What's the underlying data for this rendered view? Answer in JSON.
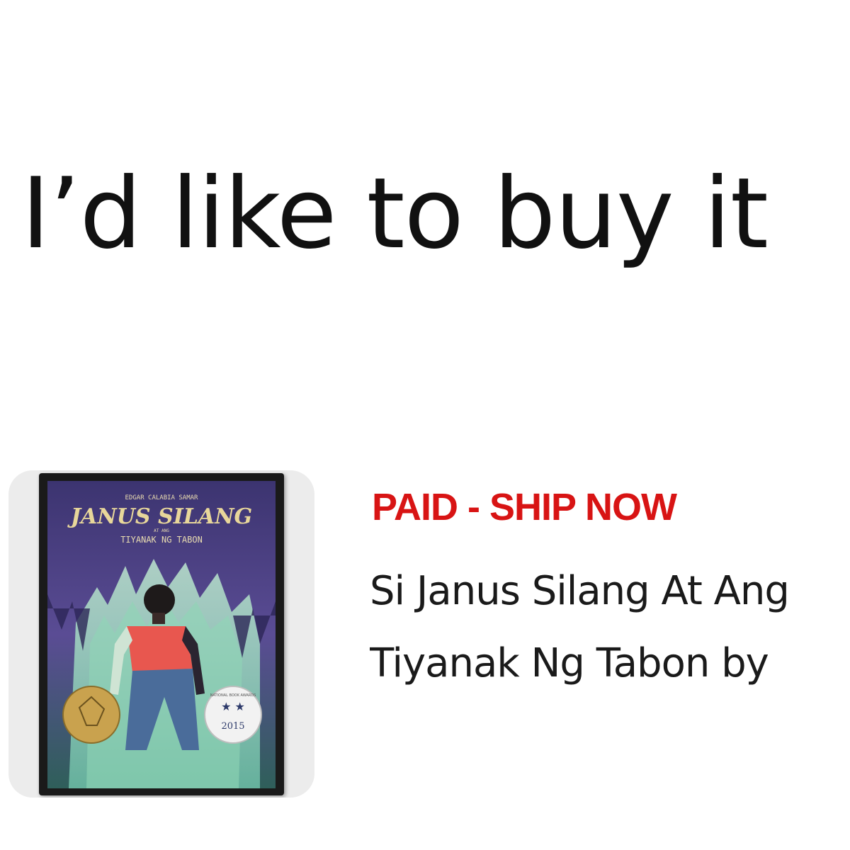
{
  "headline": "I’d like to buy it",
  "listing": {
    "status": "PAID - SHIP NOW",
    "title_line_1": "Si Janus Silang At Ang",
    "title_line_2": "Tiyanak Ng Tabon by",
    "thumbnail": {
      "cover_author": "EDGAR CALABIA SAMAR",
      "cover_title": "JANUS SILANG",
      "cover_subtitle_small": "AT ANG",
      "cover_subtitle": "TIYANAK NG TABON",
      "badge_year": "2015",
      "badge_text": "NATIONAL BOOK AWARDS"
    }
  },
  "colors": {
    "status": "#d81414",
    "text": "#111111",
    "cover_bg": "#4a3f7a",
    "shirt": "#e8574f"
  }
}
